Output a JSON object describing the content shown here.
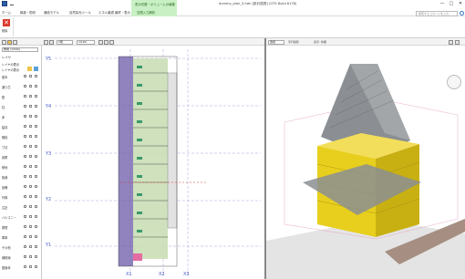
{
  "titlebar": {
    "app_icon": "save-icon",
    "context_tab_group": "表示切替・ボリュームの編集",
    "window_title": "dummy_plan_3.hdrl [設計図書] (GTS Build 6178)",
    "minimize": "—",
    "maximize": "□",
    "close": "✕"
  },
  "tabs": [
    {
      "label": "ホーム"
    },
    {
      "label": "構造・防耐"
    },
    {
      "label": "通信モデル"
    },
    {
      "label": "自然採光ツール"
    },
    {
      "label": "エネル最適"
    },
    {
      "label": "最終・表示"
    }
  ],
  "context_tab": "空間入力解析",
  "search": {
    "placeholder": "検索するコマンドを入力"
  },
  "ribbon": {
    "delete_label": "削除"
  },
  "left_panel": {
    "combo": "敷地 (1/500)",
    "layer_title": "レイヤ",
    "header_a": "レイヤの表示",
    "header_b": "レイヤの表示",
    "rows": [
      {
        "label": "基本"
      },
      {
        "label": "通り芯"
      },
      {
        "label": "壁"
      },
      {
        "label": "柱"
      },
      {
        "label": "床"
      },
      {
        "label": "建具"
      },
      {
        "label": "階段"
      },
      {
        "label": "寸法"
      },
      {
        "label": "部屋"
      },
      {
        "label": "敷地"
      },
      {
        "label": "植栽"
      },
      {
        "label": "設備"
      },
      {
        "label": "外構"
      },
      {
        "label": "注記"
      },
      {
        "label": "バルコニー"
      },
      {
        "label": "屋根"
      },
      {
        "label": "車庫"
      },
      {
        "label": "その他"
      },
      {
        "label": "補助線"
      },
      {
        "label": "図面枠"
      }
    ]
  },
  "plan_view": {
    "toolbar": {
      "floor": "1階",
      "scale": "1/100"
    },
    "grid_rows": [
      "Y5",
      "Y4",
      "Y3",
      "Y2",
      "Y1"
    ],
    "grid_cols": [
      "X1",
      "X2",
      "X3"
    ]
  },
  "view3d": {
    "toolbar": {
      "mode": "透視",
      "display": "平行投影",
      "source": "表示: 外観"
    }
  },
  "colors": {
    "context_tab": "#c9f0c4",
    "grid": "#4a56c9",
    "building_yellow": "#e8cf1e",
    "roof_gray": "#8b8f93",
    "delete_red": "#d9362b",
    "plan_volume": "#6b5aa8"
  }
}
